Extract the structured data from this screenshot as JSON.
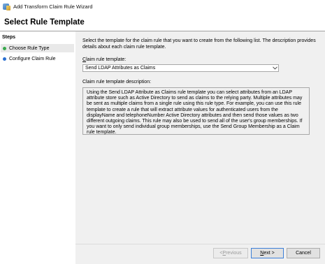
{
  "window": {
    "title": "Add Transform Claim Rule Wizard"
  },
  "header": {
    "title": "Select Rule Template"
  },
  "steps": {
    "title": "Steps",
    "items": [
      {
        "label": "Choose Rule Type",
        "status": "current",
        "color": "#39a84c"
      },
      {
        "label": "Configure Claim Rule",
        "status": "pending",
        "color": "#2b6fd1"
      }
    ]
  },
  "main": {
    "intro": "Select the template for the claim rule that you want to create from the following list. The description provides details about each claim rule template.",
    "template_label_prefix": "",
    "template_label_accel": "C",
    "template_label_rest": "laim rule template:",
    "template_selected": "Send LDAP Attributes as Claims",
    "description_label": "Claim rule template description:",
    "description": "Using the Send LDAP Attribute as Claims rule template you can select attributes from an LDAP attribute store such as Active Directory to send as claims to the relying party. Multiple attributes may be sent as multiple claims from a single rule using this rule type. For example, you can use this rule template to create a rule that will extract attribute values for authenticated users from the displayName and telephoneNumber Active Directory attributes and then send those values as two different outgoing claims. This rule may also be used to send all of the user's group memberships. If you want to only send individual group memberships, use the Send Group Membership as a Claim rule template."
  },
  "buttons": {
    "previous": {
      "prefix": "< ",
      "accel": "P",
      "rest": "revious",
      "enabled": false
    },
    "next": {
      "accel": "N",
      "rest": "ext >",
      "enabled": true
    },
    "cancel": {
      "label": "Cancel",
      "enabled": true
    }
  }
}
